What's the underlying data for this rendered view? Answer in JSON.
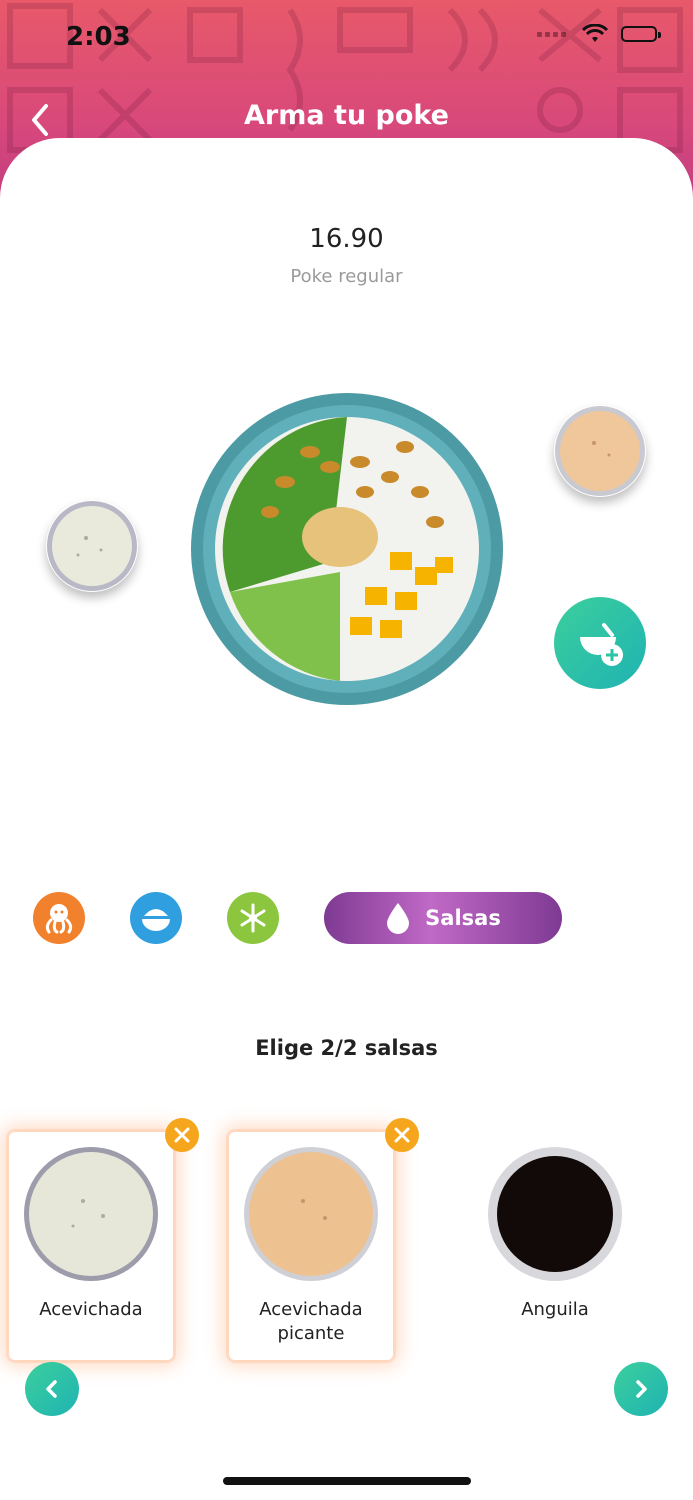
{
  "status_bar": {
    "time": "2:03"
  },
  "header": {
    "title": "Arma tu poke",
    "back_icon": "chevron-left-icon"
  },
  "summary": {
    "price": "16.90",
    "size": "Poke regular"
  },
  "categories": [
    {
      "icon": "octopus-icon",
      "color": "#f2812e"
    },
    {
      "icon": "rice-bowl-icon",
      "color": "#2f9fe0"
    },
    {
      "icon": "snowflake-icon",
      "color": "#8cc63f"
    }
  ],
  "active_category": {
    "label": "Salsas",
    "icon": "drop-icon"
  },
  "instruction": "Elige 2/2 salsas",
  "sauces": [
    {
      "name": "Acevichada",
      "selected": true
    },
    {
      "name": "Acevichada picante",
      "selected": true
    },
    {
      "name": "Anguila",
      "selected": false
    }
  ],
  "colors": {
    "accent_green": "#2cc3a6",
    "accent_purple": "#8a3f9c",
    "badge_orange": "#f6a61c"
  }
}
